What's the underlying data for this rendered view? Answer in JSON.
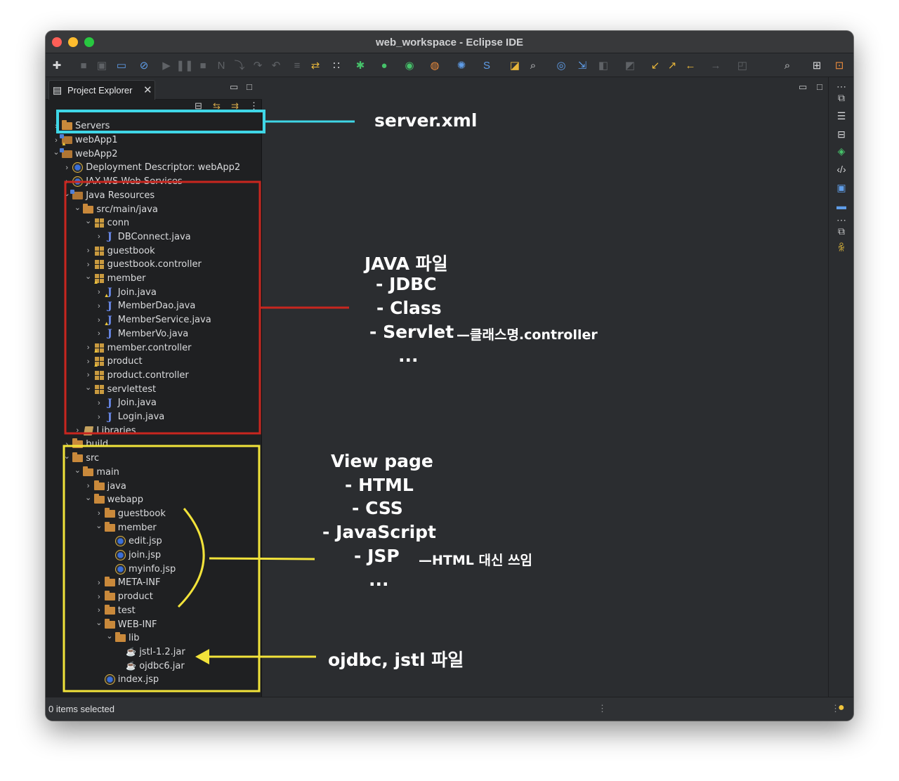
{
  "window": {
    "title": "web_workspace - Eclipse IDE"
  },
  "explorer": {
    "tab_label": "Project Explorer",
    "tree": [
      {
        "label": "Servers",
        "depth": 0,
        "state": "collapsed",
        "icon": "folder"
      },
      {
        "label": "webApp1",
        "depth": 0,
        "state": "collapsed",
        "icon": "project-warning"
      },
      {
        "label": "webApp2",
        "depth": 0,
        "state": "expanded",
        "icon": "project"
      },
      {
        "label": "Deployment Descriptor: webApp2",
        "depth": 1,
        "state": "collapsed",
        "icon": "deployment-descriptor"
      },
      {
        "label": "JAX-WS Web Services",
        "depth": 1,
        "state": "collapsed",
        "icon": "web-services"
      },
      {
        "label": "Java Resources",
        "depth": 1,
        "state": "expanded",
        "icon": "java-resources"
      },
      {
        "label": "src/main/java",
        "depth": 2,
        "state": "expanded",
        "icon": "source-folder"
      },
      {
        "label": "conn",
        "depth": 3,
        "state": "expanded",
        "icon": "package"
      },
      {
        "label": "DBConnect.java",
        "depth": 4,
        "state": "collapsed",
        "icon": "java-file"
      },
      {
        "label": "guestbook",
        "depth": 3,
        "state": "collapsed",
        "icon": "package"
      },
      {
        "label": "guestbook.controller",
        "depth": 3,
        "state": "collapsed",
        "icon": "package"
      },
      {
        "label": "member",
        "depth": 3,
        "state": "expanded",
        "icon": "package-warning"
      },
      {
        "label": "Join.java",
        "depth": 4,
        "state": "collapsed",
        "icon": "java-file-warning"
      },
      {
        "label": "MemberDao.java",
        "depth": 4,
        "state": "collapsed",
        "icon": "java-file"
      },
      {
        "label": "MemberService.java",
        "depth": 4,
        "state": "collapsed",
        "icon": "java-file-warning"
      },
      {
        "label": "MemberVo.java",
        "depth": 4,
        "state": "collapsed",
        "icon": "java-file"
      },
      {
        "label": "member.controller",
        "depth": 3,
        "state": "collapsed",
        "icon": "package-warning"
      },
      {
        "label": "product",
        "depth": 3,
        "state": "collapsed",
        "icon": "package-warning"
      },
      {
        "label": "product.controller",
        "depth": 3,
        "state": "collapsed",
        "icon": "package"
      },
      {
        "label": "servlettest",
        "depth": 3,
        "state": "expanded",
        "icon": "package"
      },
      {
        "label": "Join.java",
        "depth": 4,
        "state": "collapsed",
        "icon": "java-file"
      },
      {
        "label": "Login.java",
        "depth": 4,
        "state": "collapsed",
        "icon": "java-file"
      },
      {
        "label": "Libraries",
        "depth": 2,
        "state": "collapsed",
        "icon": "library"
      },
      {
        "label": "build",
        "depth": 1,
        "state": "collapsed",
        "icon": "folder"
      },
      {
        "label": "src",
        "depth": 1,
        "state": "expanded",
        "icon": "folder"
      },
      {
        "label": "main",
        "depth": 2,
        "state": "expanded",
        "icon": "folder"
      },
      {
        "label": "java",
        "depth": 3,
        "state": "collapsed",
        "icon": "folder"
      },
      {
        "label": "webapp",
        "depth": 3,
        "state": "expanded",
        "icon": "folder"
      },
      {
        "label": "guestbook",
        "depth": 4,
        "state": "collapsed",
        "icon": "folder"
      },
      {
        "label": "member",
        "depth": 4,
        "state": "expanded",
        "icon": "folder"
      },
      {
        "label": "edit.jsp",
        "depth": 5,
        "state": "leaf",
        "icon": "jsp-file"
      },
      {
        "label": "join.jsp",
        "depth": 5,
        "state": "leaf",
        "icon": "jsp-file"
      },
      {
        "label": "myinfo.jsp",
        "depth": 5,
        "state": "leaf",
        "icon": "jsp-file"
      },
      {
        "label": "META-INF",
        "depth": 4,
        "state": "collapsed",
        "icon": "folder"
      },
      {
        "label": "product",
        "depth": 4,
        "state": "collapsed",
        "icon": "folder"
      },
      {
        "label": "test",
        "depth": 4,
        "state": "collapsed",
        "icon": "folder"
      },
      {
        "label": "WEB-INF",
        "depth": 4,
        "state": "expanded",
        "icon": "folder"
      },
      {
        "label": "lib",
        "depth": 5,
        "state": "expanded",
        "icon": "folder"
      },
      {
        "label": "jstl-1.2.jar",
        "depth": 6,
        "state": "leaf",
        "icon": "jar-file"
      },
      {
        "label": "ojdbc6.jar",
        "depth": 6,
        "state": "leaf",
        "icon": "jar-file"
      },
      {
        "label": "index.jsp",
        "depth": 4,
        "state": "leaf",
        "icon": "jsp-file"
      }
    ]
  },
  "status": {
    "text": "0 items selected"
  },
  "annotations": {
    "server": "server.xml",
    "java_title": "JAVA 파일",
    "java_jdbc": "- JDBC",
    "java_class": "- Class",
    "java_servlet": "- Servlet",
    "java_servlet_note": "—클래스명.controller",
    "java_more": "...",
    "view_title": "View page",
    "view_html": "- HTML",
    "view_css": "- CSS",
    "view_js": "- JavaScript",
    "view_jsp": "- JSP",
    "view_jsp_note": "—HTML 대신 쓰임",
    "view_more": "...",
    "lib_note": "ojdbc, jstl 파일"
  },
  "colors": {
    "cyan_box": "#3fd6e6",
    "red_box": "#c8261f",
    "yellow_box": "#f2e33a"
  }
}
